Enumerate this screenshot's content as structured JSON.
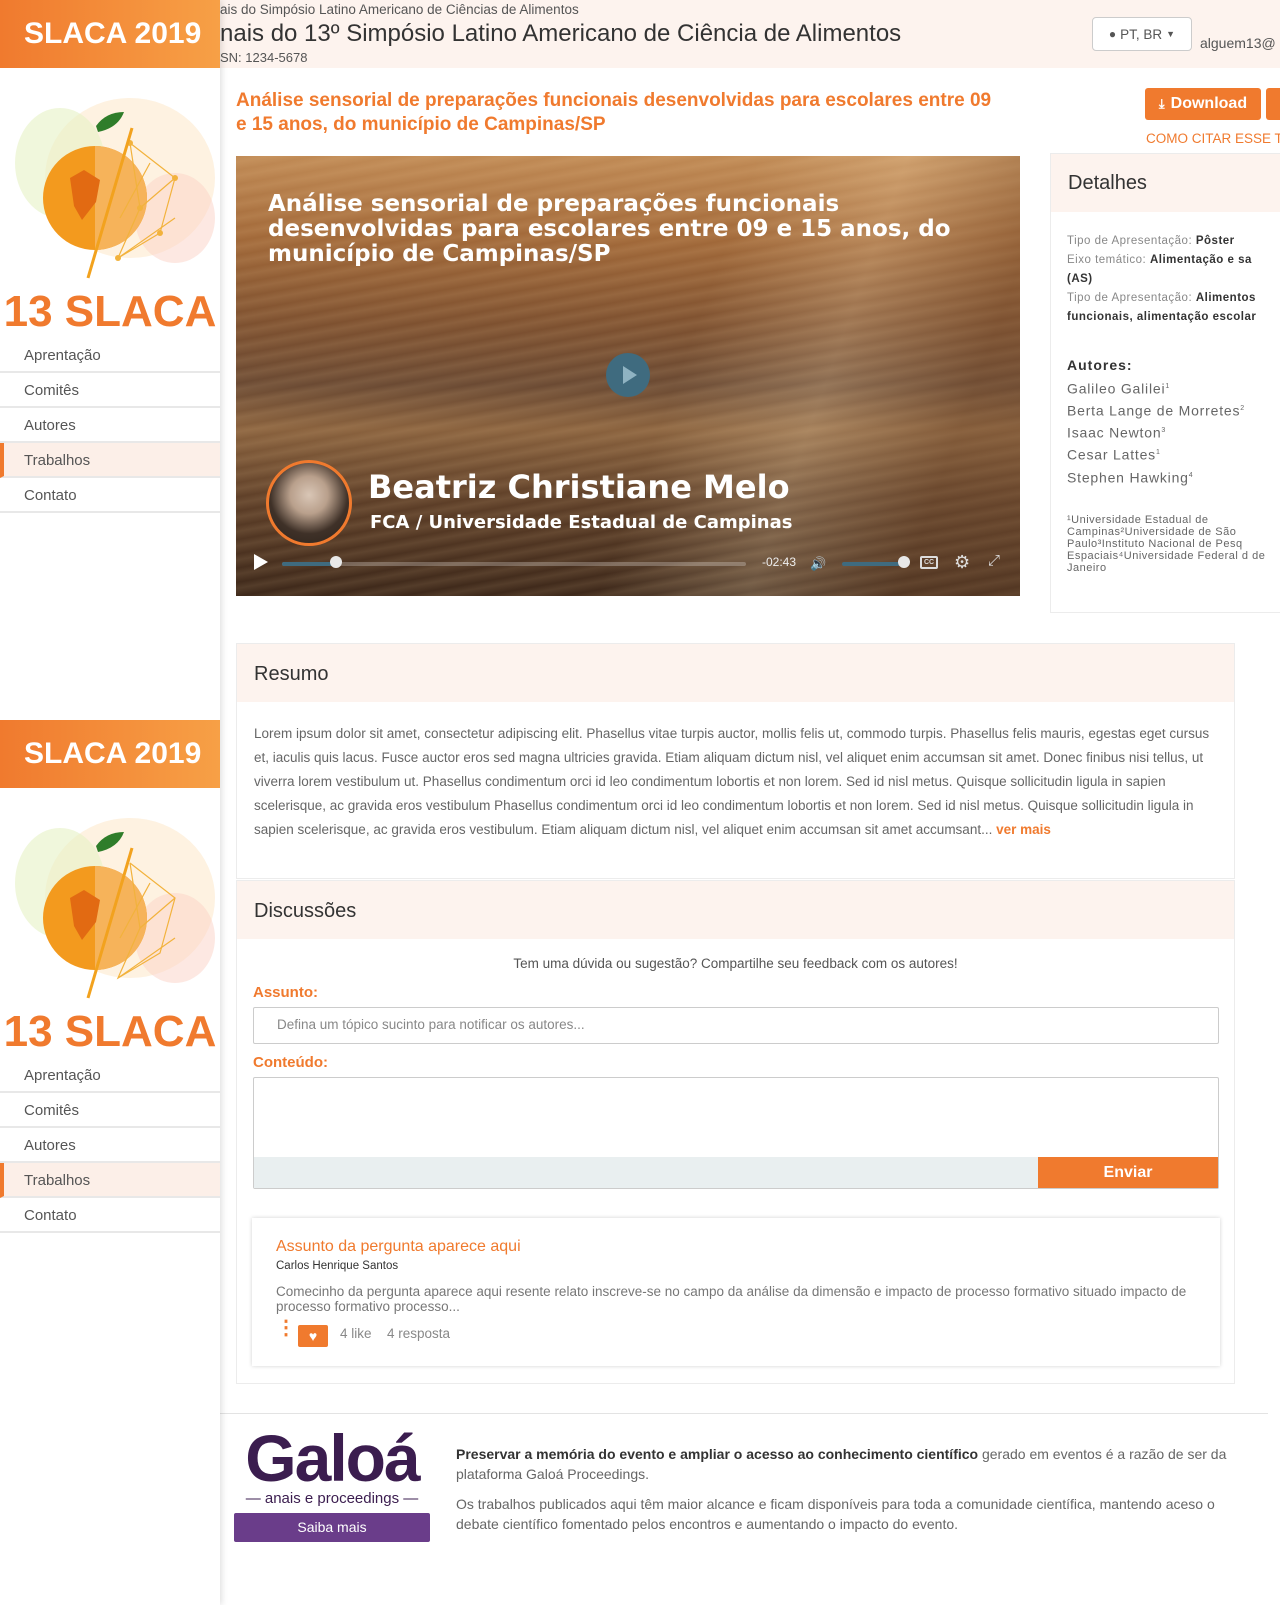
{
  "sidebar": {
    "brand": "SLACA 2019",
    "logo_text": "13 SLACA",
    "items": [
      "Aprentação",
      "Comitês",
      "Autores",
      "Trabalhos",
      "Contato"
    ]
  },
  "header": {
    "subtitle": "ais do Simpósio Latino Americano de Ciências de Alimentos",
    "title": "nais do 13º Simpósio Latino Americano de Ciência de Alimentos",
    "issn": "SN: 1234-5678",
    "language": "PT, BR",
    "user": "alguem13@"
  },
  "paper": {
    "title": "Análise sensorial de preparações funcionais desenvolvidas para escolares entre 09 e 15 anos, do município de Campinas/SP",
    "download_label": "Download",
    "cite_label": "COMO CITAR ESSE T"
  },
  "video": {
    "title": "Análise sensorial de preparações funcionais desenvolvidas para escolares entre 09 e 15 anos, do município de Campinas/SP",
    "presenter": "Beatriz Christiane Melo",
    "institution": "FCA / Universidade Estadual de Campinas",
    "time_remaining": "-02:43",
    "progress": 0.12
  },
  "details": {
    "heading": "Detalhes",
    "rows": [
      {
        "label": "Tipo de Apresentação:",
        "value": "Pôster"
      },
      {
        "label": "Eixo temático:",
        "value": "Alimentação e sa"
      },
      {
        "label": "",
        "value": "(AS)"
      },
      {
        "label": "Tipo de Apresentação:",
        "value": "Alimentos"
      },
      {
        "label": "",
        "value": "funcionais, alimentação escolar"
      }
    ],
    "authors_heading": "Autores:",
    "authors": [
      {
        "name": "Galileo Galilei",
        "sup": "1"
      },
      {
        "name": "Berta Lange de Morretes",
        "sup": "2"
      },
      {
        "name": "Isaac Newton",
        "sup": "3"
      },
      {
        "name": "Cesar Lattes",
        "sup": "1"
      },
      {
        "name": "Stephen Hawking",
        "sup": "4"
      }
    ],
    "affiliations": "¹Universidade Estadual de Campinas²Universidade de São Paulo³Instituto Nacional de Pesq Espaciais⁴Universidade Federal d de Janeiro"
  },
  "resumo": {
    "heading": "Resumo",
    "text": "Lorem ipsum dolor sit amet, consectetur adipiscing elit. Phasellus vitae turpis auctor, mollis felis ut, commodo turpis. Phasellus felis mauris, egestas eget cursus et, iaculis quis lacus. Fusce auctor eros sed magna ultricies gravida. Etiam aliquam dictum nisl, vel aliquet enim accumsan sit amet. Donec finibus nisi tellus, ut viverra lorem vestibulum ut. Phasellus condimentum orci id leo condimentum lobortis et non lorem. Sed id nisl metus. Quisque sollicitudin ligula in sapien scelerisque, ac gravida eros vestibulum Phasellus condimentum orci id leo condimentum lobortis et non lorem. Sed id nisl metus. Quisque sollicitudin ligula in sapien scelerisque, ac gravida eros vestibulum. Etiam aliquam dictum nisl, vel aliquet enim accumsan sit amet accumsant...",
    "more": "ver mais"
  },
  "discussoes": {
    "heading": "Discussões",
    "prompt": "Tem uma dúvida ou sugestão? Compartilhe seu feedback com os autores!",
    "subject_label": "Assunto:",
    "subject_placeholder": "Defina um tópico sucinto para notificar os autores...",
    "content_label": "Conteúdo:",
    "send_label": "Enviar",
    "question": {
      "title": "Assunto da pergunta aparece aqui",
      "author": "Carlos Henrique Santos",
      "body": "Comecinho da pergunta aparece aqui resente relato inscreve-se no campo da análise da dimensão e impacto de processo formativo situado impacto de processo formativo processo...",
      "likes": "4 like",
      "replies": "4 resposta"
    }
  },
  "footer": {
    "brand": "Galoá",
    "brand_sub": "anais e proceedings",
    "button": "Saiba mais",
    "bold": "Preservar a memória do evento e ampliar o acesso ao conhecimento científico",
    "text1": " gerado em eventos é a razão de ser da plataforma Galoá Proceedings.",
    "text2": "Os trabalhos publicados aqui têm maior alcance e ficam disponíveis para toda a comunidade científica, mantendo aceso o debate científico fomentado pelos encontros e aumentando o impacto do evento."
  },
  "colors": {
    "accent": "#f07a2e",
    "header_bg": "#fdf3ee",
    "brand_purple": "#3b1d4f"
  }
}
